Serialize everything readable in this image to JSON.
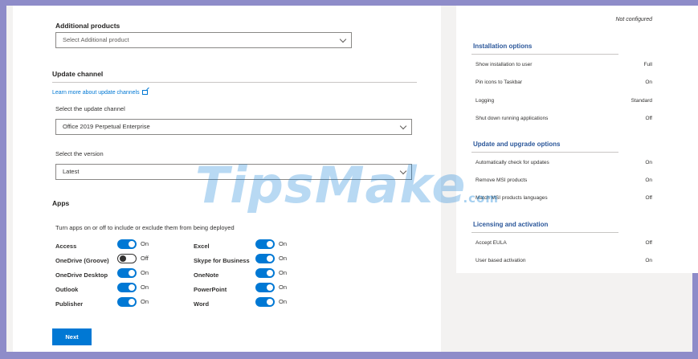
{
  "additional_products": {
    "label": "Additional products",
    "placeholder": "Select Additional product"
  },
  "update_channel": {
    "heading": "Update channel",
    "learn_more": "Learn more about update channels",
    "select_channel_label": "Select the update channel",
    "channel_value": "Office 2019 Perpetual Enterprise",
    "select_version_label": "Select the version",
    "version_value": "Latest"
  },
  "apps": {
    "heading": "Apps",
    "description": "Turn apps on or off to include or exclude them from being deployed",
    "left": [
      {
        "name": "Access",
        "state": "On"
      },
      {
        "name": "OneDrive (Groove)",
        "state": "Off"
      },
      {
        "name": "OneDrive Desktop",
        "state": "On"
      },
      {
        "name": "Outlook",
        "state": "On"
      },
      {
        "name": "Publisher",
        "state": "On"
      }
    ],
    "right": [
      {
        "name": "Excel",
        "state": "On"
      },
      {
        "name": "Skype for Business",
        "state": "On"
      },
      {
        "name": "OneNote",
        "state": "On"
      },
      {
        "name": "PowerPoint",
        "state": "On"
      },
      {
        "name": "Word",
        "state": "On"
      }
    ]
  },
  "next_button": "Next",
  "summary": {
    "top_value": "Not configured",
    "sections": [
      {
        "title": "Installation options",
        "rows": [
          {
            "label": "Show installation to user",
            "value": "Full"
          },
          {
            "label": "Pin icons to Taskbar",
            "value": "On"
          },
          {
            "label": "Logging",
            "value": "Standard"
          },
          {
            "label": "Shut down running applications",
            "value": "Off"
          }
        ]
      },
      {
        "title": "Update and upgrade options",
        "rows": [
          {
            "label": "Automatically check for updates",
            "value": "On"
          },
          {
            "label": "Remove MSI products",
            "value": "On"
          },
          {
            "label": "Match MSI products languages",
            "value": "Off"
          }
        ]
      },
      {
        "title": "Licensing and activation",
        "rows": [
          {
            "label": "Accept EULA",
            "value": "Off"
          },
          {
            "label": "User based activation",
            "value": "On"
          }
        ]
      }
    ]
  },
  "watermark": {
    "text": "TipsMake",
    "suffix": ".com"
  },
  "colors": {
    "accent": "#0078d4",
    "frame": "#8e8cc9",
    "section_heading": "#2b579a"
  }
}
